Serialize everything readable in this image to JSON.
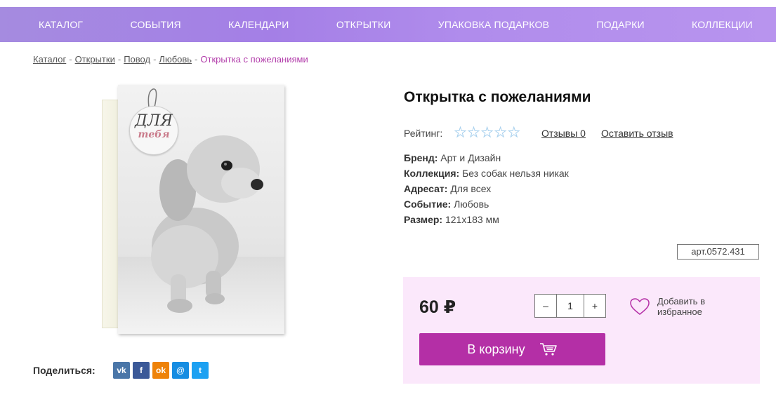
{
  "nav": {
    "items": [
      "КАТАЛОГ",
      "СОБЫТИЯ",
      "КАЛЕНДАРИ",
      "ОТКРЫТКИ",
      "УПАКОВКА ПОДАРКОВ",
      "ПОДАРКИ",
      "КОЛЛЕКЦИИ"
    ]
  },
  "breadcrumb": {
    "items": [
      "Каталог",
      "Открытки",
      "Повод",
      "Любовь"
    ],
    "separator": "-",
    "current": "Открытка с пожеланиями"
  },
  "product": {
    "title": "Открытка с пожеланиями",
    "image_tag_line1": "ДЛЯ",
    "image_tag_line2": "тебя",
    "rating_label": "Рейтинг:",
    "rating_stars": 0,
    "rating_max": 5,
    "reviews_link": "Отзывы 0",
    "leave_review_link": "Оставить отзыв",
    "properties": [
      {
        "label": "Бренд:",
        "value": "Арт и Дизайн"
      },
      {
        "label": "Коллекция:",
        "value": "Без собак нельзя никак"
      },
      {
        "label": "Адресат:",
        "value": "Для всех"
      },
      {
        "label": "Событие:",
        "value": "Любовь"
      },
      {
        "label": "Размер:",
        "value": "121x183 мм"
      }
    ],
    "sku": "арт.0572.431"
  },
  "buy": {
    "price": "60 ₽",
    "qty_minus": "–",
    "quantity": "1",
    "qty_plus": "+",
    "favorite_label": "Добавить в избранное",
    "cart_button": "В корзину"
  },
  "share": {
    "label": "Поделиться:",
    "networks": [
      {
        "icon": "vk-icon",
        "glyph": "vk",
        "color": "#4a76a8"
      },
      {
        "icon": "facebook-icon",
        "glyph": "f",
        "color": "#3b5998"
      },
      {
        "icon": "odnoklassniki-icon",
        "glyph": "ok",
        "color": "#ee8208"
      },
      {
        "icon": "moimir-icon",
        "glyph": "@",
        "color": "#168de2"
      },
      {
        "icon": "twitter-icon",
        "glyph": "t",
        "color": "#1da1f2"
      }
    ]
  },
  "colors": {
    "accent": "#b42fa6",
    "buybox_bg": "#fbe8fb",
    "breadcrumb_current": "#b23caa"
  }
}
